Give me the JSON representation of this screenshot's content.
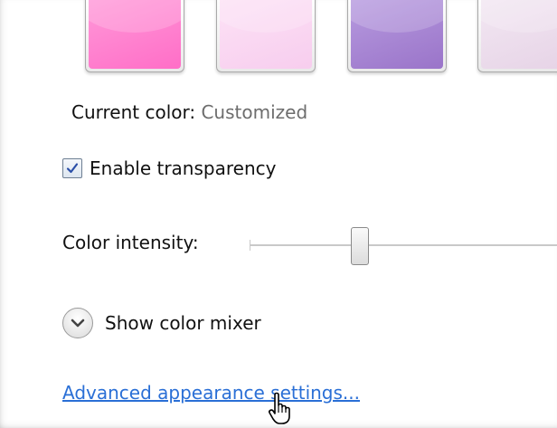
{
  "swatches": [
    {
      "name": "pink",
      "color": "#ff6ec7",
      "color_hi": "#ff9ad9"
    },
    {
      "name": "light-pink",
      "color": "#f7cdee",
      "color_hi": "#fde3f6"
    },
    {
      "name": "violet",
      "color": "#9a74c9",
      "color_hi": "#b89ce0"
    },
    {
      "name": "lavender",
      "color": "#e6d3e6",
      "color_hi": "#f3e8f3"
    }
  ],
  "current_color": {
    "label": "Current color:",
    "value": "Customized"
  },
  "transparency": {
    "label": "Enable transparency",
    "checked": true
  },
  "intensity": {
    "label": "Color intensity:",
    "value": 0.36
  },
  "mixer": {
    "label": "Show color mixer",
    "icon": "chevron-down-icon"
  },
  "advanced_link": {
    "label": "Advanced appearance settings..."
  },
  "cursor": {
    "icon": "hand-pointer-icon"
  },
  "colors": {
    "link": "#2a6fd6",
    "secondary_text": "#6d6d6d"
  }
}
